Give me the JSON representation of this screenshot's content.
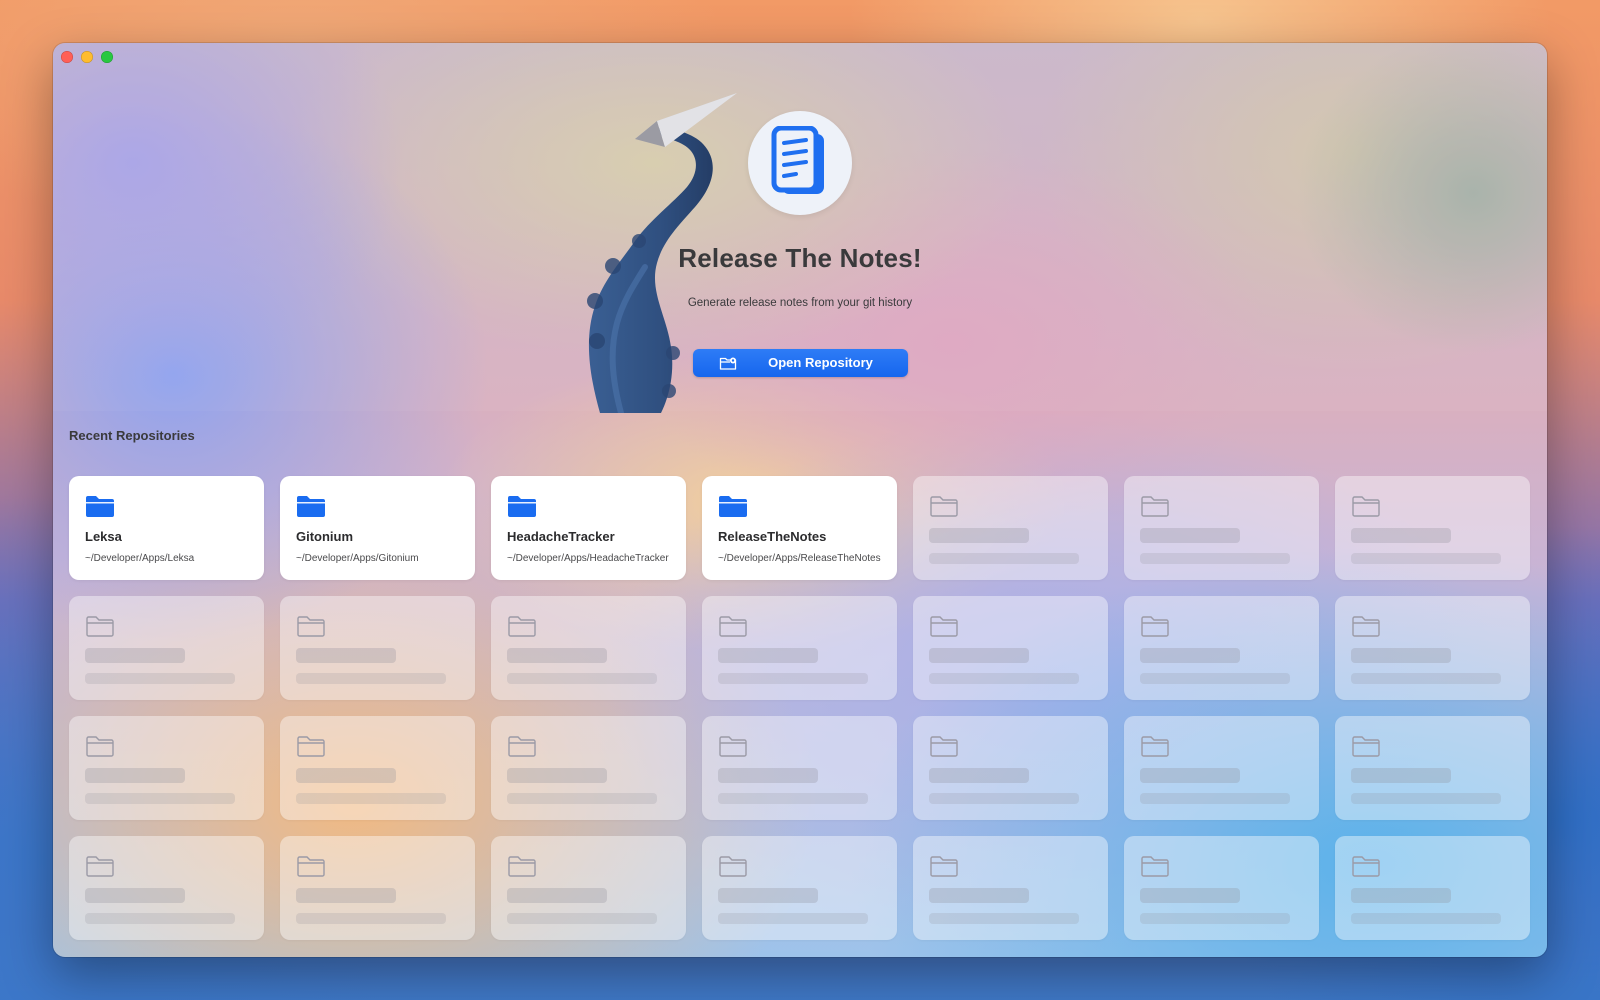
{
  "app": {
    "title": "Release The Notes!",
    "subtitle": "Generate release notes from your git history",
    "open_button_label": "Open Repository",
    "icon": "document-pages-icon",
    "accent_color": "#1a6cf0"
  },
  "recent": {
    "title": "Recent Repositories",
    "items": [
      {
        "name": "Leksa",
        "path": "~/Developer/Apps/Leksa"
      },
      {
        "name": "Gitonium",
        "path": "~/Developer/Apps/Gitonium"
      },
      {
        "name": "HeadacheTracker",
        "path": "~/Developer/Apps/HeadacheTracker"
      },
      {
        "name": "ReleaseTheNotes",
        "path": "~/Developer/Apps/ReleaseTheNotes"
      }
    ]
  }
}
